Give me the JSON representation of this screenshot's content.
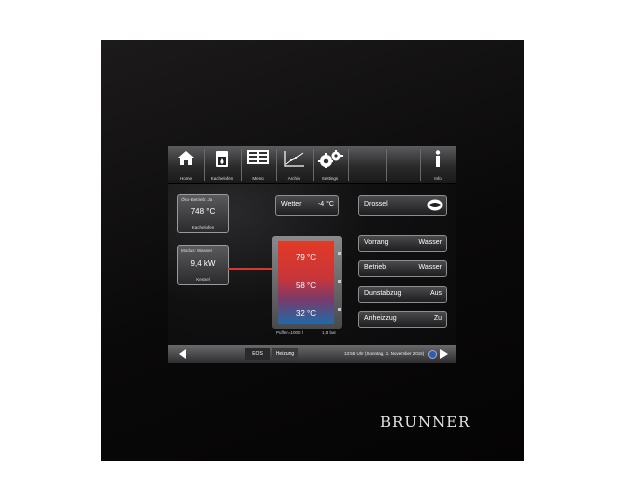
{
  "brand": "BRUNNER",
  "nav": [
    {
      "label": "Home",
      "icon": "home-icon"
    },
    {
      "label": "Kachelofen",
      "icon": "stove-icon"
    },
    {
      "label": "Menü",
      "icon": "menu-icon"
    },
    {
      "label": "Archiv",
      "icon": "chart-icon"
    },
    {
      "label": "Settings",
      "icon": "gears-icon"
    },
    {
      "label": "Info",
      "icon": "info-icon"
    }
  ],
  "kachelofen": {
    "status": "Öko-Betrieb: Ja",
    "value": "748 °C",
    "caption": "Kachelofen"
  },
  "kessel": {
    "status": "Modus: Wasser",
    "value": "9,4 kW",
    "caption": "Kessel"
  },
  "weather": {
    "label": "Wetter",
    "value": "-4 °C"
  },
  "buffer": {
    "t1": "79 °C",
    "t2": "58 °C",
    "t3": "32 °C",
    "left": "Puffer=1000 l",
    "right": "1,8 bar"
  },
  "controls": {
    "drossel": "Drossel",
    "vorrang": {
      "label": "Vorrang",
      "value": "Wasser"
    },
    "betrieb": {
      "label": "Betrieb",
      "value": "Wasser"
    },
    "dunstabzug": {
      "label": "Dunstabzug",
      "value": "Aus"
    },
    "anheizzug": {
      "label": "Anheizzug",
      "value": "Zu"
    }
  },
  "bottom": {
    "tab1": "EOS",
    "tab2": "Heizung",
    "status": "13:55 Uhr (Sonntag, 1. November 2015)"
  },
  "colors": {
    "hot": "#e0382a",
    "warm": "#c23a44",
    "cold": "#1e6ea8",
    "accent_line": "#d43a30"
  }
}
